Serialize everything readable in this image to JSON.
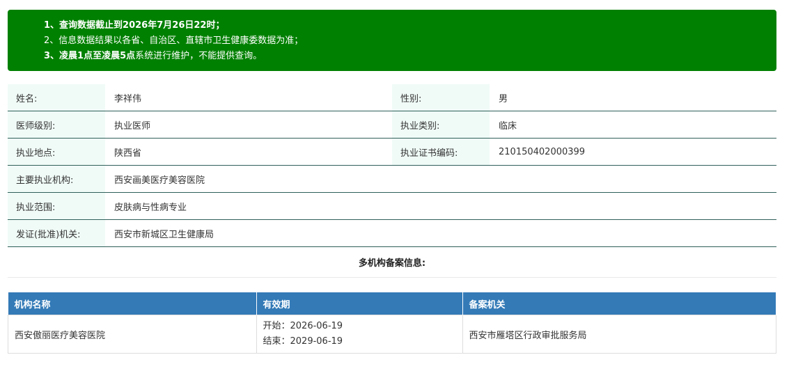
{
  "notice": {
    "line1": "1、查询数据截止到2026年7月26日22时；",
    "line2": "2、信息数据结果以各省、自治区、直辖市卫生健康委数据为准；",
    "line3_bold": "3、凌晨1点至凌晨5点",
    "line3_rest": "系统进行维护，不能提供查询。"
  },
  "info": {
    "name_label": "姓名:",
    "name_value": "李祥伟",
    "gender_label": "性别:",
    "gender_value": "男",
    "level_label": "医师级别:",
    "level_value": "执业医师",
    "category_label": "执业类别:",
    "category_value": "临床",
    "location_label": "执业地点:",
    "location_value": "陕西省",
    "cert_label": "执业证书编码:",
    "cert_value": "210150402000399",
    "org_label": "主要执业机构:",
    "org_value": "西安画美医疗美容医院",
    "scope_label": "执业范围:",
    "scope_value": "皮肤病与性病专业",
    "issuer_label": "发证(批准)机关:",
    "issuer_value": "西安市新城区卫生健康局"
  },
  "multi": {
    "title": "多机构备案信息:",
    "headers": [
      "机构名称",
      "有效期",
      "备案机关"
    ],
    "rows": [
      {
        "org": "西安傲丽医疗美容医院",
        "start": "开始：2026-06-19",
        "end": "结束：2029-06-19",
        "authority": "西安市雁塔区行政审批服务局"
      }
    ]
  }
}
